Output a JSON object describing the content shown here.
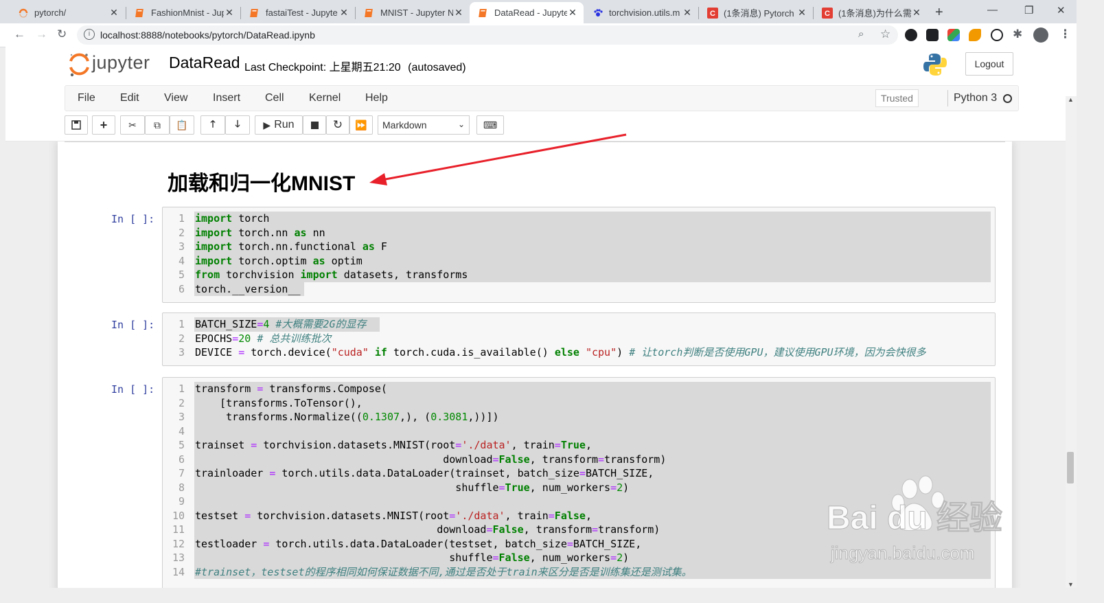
{
  "browser": {
    "tabs": [
      {
        "label": "pytorch/",
        "icon": "jupyter-spinner-icon"
      },
      {
        "label": "FashionMnist - Jup",
        "icon": "notebook-icon"
      },
      {
        "label": "fastaiTest - Jupyte",
        "icon": "notebook-icon"
      },
      {
        "label": "MNIST - Jupyter N",
        "icon": "notebook-icon"
      },
      {
        "label": "DataRead - Jupyte",
        "icon": "notebook-icon",
        "active": true
      },
      {
        "label": "torchvision.utils.m",
        "icon": "paw-icon"
      },
      {
        "label": "(1条消息) Pytorch",
        "icon": "csdn-icon"
      },
      {
        "label": "(1条消息)为什么需要",
        "icon": "csdn-icon"
      }
    ],
    "new_tab": "+",
    "url": "localhost:8888/notebooks/pytorch/DataRead.ipynb"
  },
  "jupyter": {
    "logo_text": "jupyter",
    "notebook_name": "DataRead",
    "checkpoint_label": "Last Checkpoint:",
    "checkpoint_time": "上星期五21:20",
    "autosaved": "(autosaved)",
    "logout": "Logout",
    "menu": [
      "File",
      "Edit",
      "View",
      "Insert",
      "Cell",
      "Kernel",
      "Help"
    ],
    "trusted": "Trusted",
    "kernel": "Python 3",
    "run_label": "Run",
    "cell_type": "Markdown"
  },
  "notebook": {
    "heading": "加载和归一化MNIST",
    "prompt": "In [ ]:",
    "cells": [
      {
        "lines": [
          "1",
          "2",
          "3",
          "4",
          "5",
          "6"
        ]
      }
    ]
  },
  "watermark": {
    "brand": "Bai du 经验",
    "domain": "jingyan.baidu.com"
  },
  "colors": {
    "keyword": "#008000",
    "string": "#ba2121",
    "number": "#008800",
    "comment": "#408080",
    "operator": "#aa22ff",
    "prompt": "#303f9f",
    "arrow": "#e8202a"
  }
}
